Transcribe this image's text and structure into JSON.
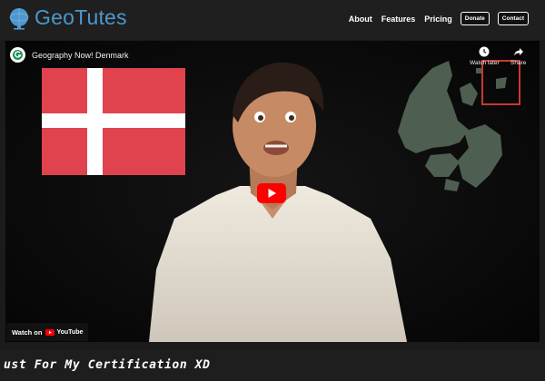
{
  "brand": {
    "name": "GeoTutes",
    "color": "#4d97cc"
  },
  "nav": {
    "links": [
      "About",
      "Features",
      "Pricing"
    ],
    "buttons": [
      "Donate",
      "Contact"
    ]
  },
  "video": {
    "title": "Geography Now! Denmark",
    "watch_later": "Watch later",
    "share": "Share",
    "watch_on": "Watch on",
    "platform": "YouTube",
    "icons": [
      "clock-icon",
      "share-arrow-icon",
      "play-icon",
      "youtube-logo-icon"
    ]
  },
  "caption": {
    "text": "ust For My Certification XD"
  },
  "colors": {
    "background": "#1b1b1b",
    "flag_red": "#e0424e",
    "play_red": "#ff0000"
  }
}
